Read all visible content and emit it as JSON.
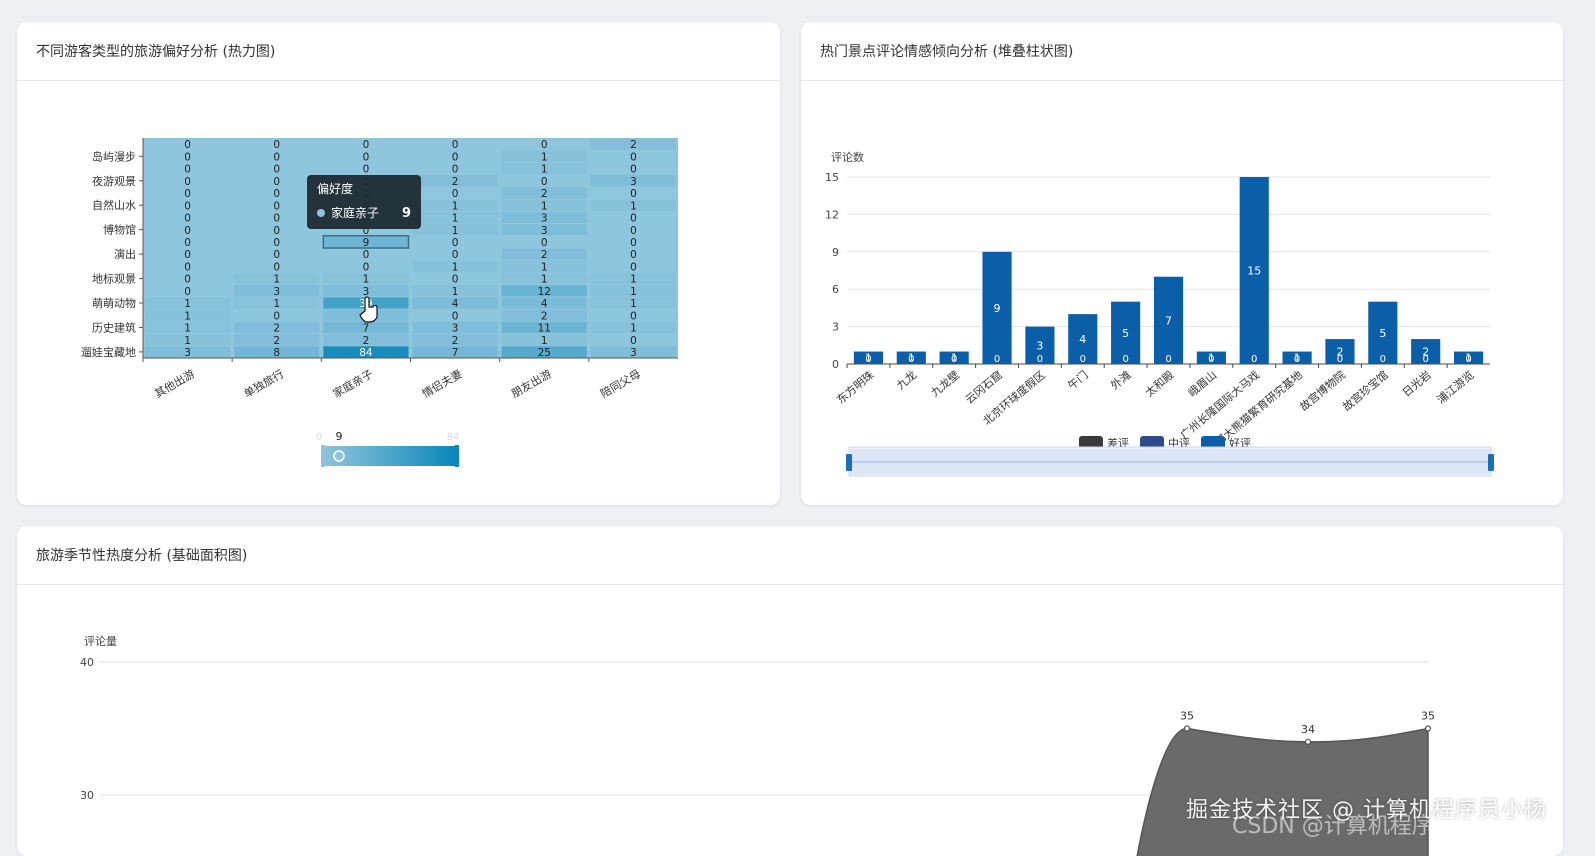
{
  "heatmap_card": {
    "title": "不同游客类型的旅游偏好分析 (热力图)",
    "tooltip": {
      "title": "偏好度",
      "series": "家庭亲子",
      "value": "9"
    },
    "visual_map": {
      "min": "0",
      "max": "84",
      "handle_value": "9"
    }
  },
  "stacked_card": {
    "title": "热门景点评论情感倾向分析 (堆叠柱状图)"
  },
  "area_card": {
    "title": "旅游季节性热度分析 (基础面积图)"
  },
  "watermark": {
    "line1": "掘金技术社区 @ 计算机程序员小杨",
    "line2": "CSDN @计算机程序员小杨"
  },
  "chart_data": [
    {
      "type": "heatmap",
      "x_categories": [
        "其他出游",
        "单独旅行",
        "家庭亲子",
        "情侣夫妻",
        "朋友出游",
        "陪同父母"
      ],
      "y_labels_printed": [
        "岛屿漫步",
        "夜游观景",
        "自然山水",
        "博物馆",
        "演出",
        "地标观景",
        "萌萌动物",
        "历史建筑",
        "遛娃宝藏地"
      ],
      "rows": [
        [
          0,
          0,
          0,
          0,
          0,
          2
        ],
        [
          0,
          0,
          0,
          0,
          1,
          0
        ],
        [
          0,
          0,
          0,
          0,
          1,
          0
        ],
        [
          0,
          0,
          0,
          2,
          0,
          3
        ],
        [
          0,
          0,
          0,
          0,
          2,
          0
        ],
        [
          0,
          0,
          0,
          1,
          1,
          1
        ],
        [
          0,
          0,
          0,
          1,
          3,
          0
        ],
        [
          0,
          0,
          0,
          1,
          3,
          0
        ],
        [
          0,
          0,
          9,
          0,
          0,
          0
        ],
        [
          0,
          0,
          0,
          0,
          2,
          0
        ],
        [
          0,
          0,
          0,
          1,
          1,
          0
        ],
        [
          0,
          1,
          1,
          0,
          1,
          1
        ],
        [
          0,
          3,
          3,
          1,
          12,
          1
        ],
        [
          1,
          1,
          39,
          4,
          4,
          1
        ],
        [
          1,
          0,
          3,
          0,
          2,
          0
        ],
        [
          1,
          2,
          7,
          3,
          11,
          1
        ],
        [
          1,
          2,
          2,
          2,
          1,
          0
        ],
        [
          3,
          8,
          84,
          7,
          25,
          3
        ]
      ],
      "value_range": [
        0,
        84
      ],
      "colors": {
        "low": "#8ec6de",
        "high": "#0a86b8"
      }
    },
    {
      "type": "bar",
      "stacked": true,
      "ylabel": "评论数",
      "ylim": [
        0,
        15
      ],
      "yticks": [
        0,
        3,
        6,
        9,
        12,
        15
      ],
      "categories": [
        "东方明珠",
        "九龙",
        "九龙壁",
        "云冈石窟",
        "北京环球度假区",
        "午门",
        "外滩",
        "太和殿",
        "峨眉山",
        "广州长隆国际大马戏",
        "成都大熊猫繁育研究基地",
        "故宫博物院",
        "故宫珍宝馆",
        "日光岩",
        "浦江游览"
      ],
      "series": [
        {
          "name": "差评",
          "color": "#3a3a3a",
          "values": [
            0,
            0,
            0,
            0,
            0,
            0,
            0,
            0,
            0,
            0,
            0,
            0,
            0,
            0,
            0
          ]
        },
        {
          "name": "中评",
          "color": "#2c4a8c",
          "values": [
            0,
            0,
            0,
            0,
            0,
            0,
            0,
            0,
            0,
            0,
            0,
            0,
            0,
            0,
            0
          ]
        },
        {
          "name": "好评",
          "color": "#0a5fa8",
          "values": [
            1,
            1,
            1,
            9,
            3,
            4,
            5,
            7,
            1,
            15,
            1,
            2,
            5,
            2,
            1
          ]
        }
      ],
      "legend_position": "bottom"
    },
    {
      "type": "area",
      "ylabel": "评论量",
      "yticks_visible": [
        30,
        40
      ],
      "points_visible": [
        35,
        34,
        35
      ],
      "color": "#6a6a6a"
    }
  ]
}
